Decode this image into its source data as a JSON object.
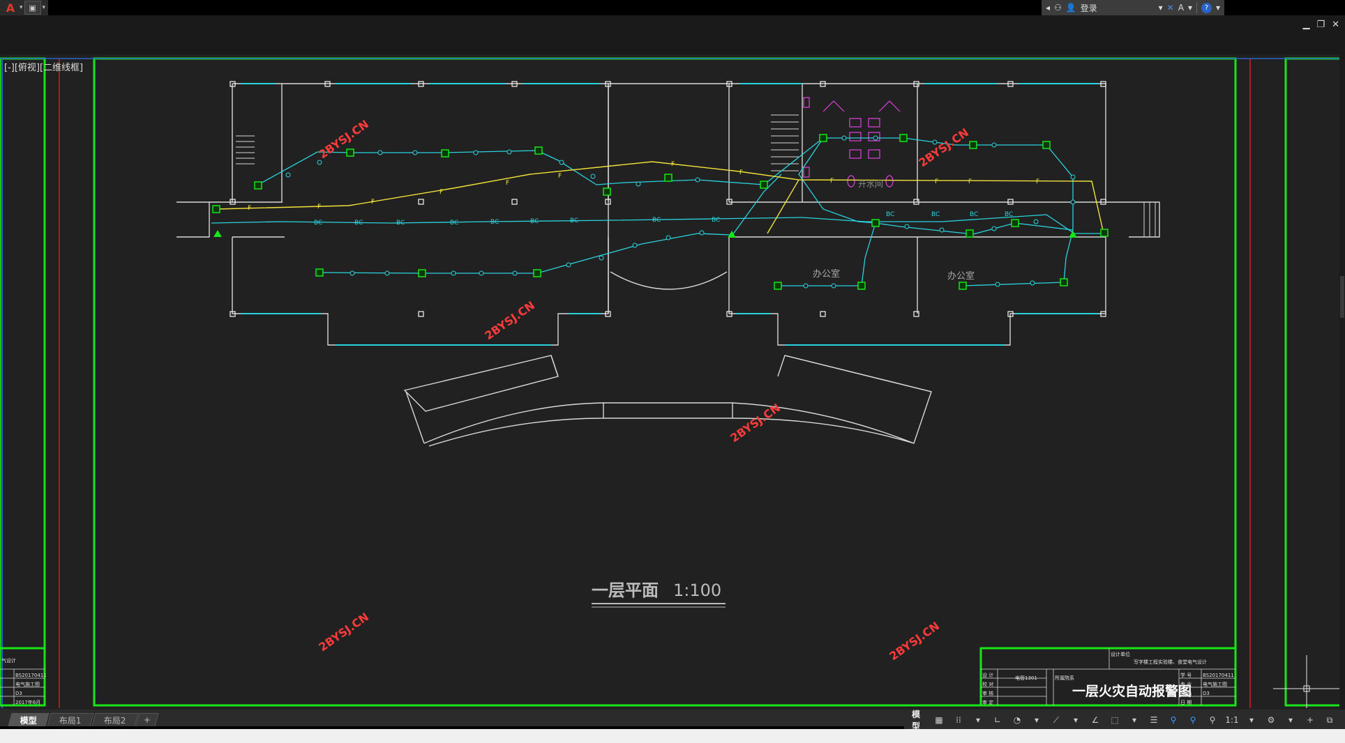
{
  "app": {
    "logo_letter": "A",
    "quick_access_icon": "save-icon"
  },
  "infocenter": {
    "login_label": "登录",
    "help_symbol": "?"
  },
  "window_controls": {
    "minimize": "▁",
    "restore": "❐",
    "close": "✕"
  },
  "viewport": {
    "view_label": "[-][俯视][二维线框]"
  },
  "drawing": {
    "watermark": "2BYSJ.CN",
    "room_office": "办公室",
    "room_stairwell": "开水间",
    "plan_title": "一层平面",
    "plan_scale": "1:100",
    "device_labels": {
      "smoke": "S",
      "fire_line": "F",
      "bc": "BC",
      "c": "C"
    }
  },
  "title_block_right": {
    "drawing_title": "一层火灾自动报警图",
    "project_name": "写字楼工程实验楼、食堂电气设计",
    "rows_left": [
      "设 计",
      "校 对",
      "审 核",
      "审 定"
    ],
    "rows_right": [
      "学 号",
      "专 业",
      "页 码",
      "日 期"
    ],
    "values_right": [
      "BS20170411",
      "电气施工图",
      "D3",
      ""
    ],
    "class_label": "电管1301",
    "school_label": "所属院系",
    "design_label": "设计单位"
  },
  "title_block_left": {
    "caption": "气设计",
    "values": [
      "BS20170411",
      "电气施工图",
      "D3",
      "2017年6月"
    ]
  },
  "layout_tabs": [
    "模型",
    "布局1",
    "布局2",
    "+"
  ],
  "statusbar": {
    "model_label": "模型",
    "scale": "1:1"
  },
  "colors": {
    "cyan": "#2ad4df",
    "yellow": "#f2e23a",
    "green": "#19e619",
    "magenta": "#e040e0",
    "red": "#e02020",
    "wall": "#d8d8d8",
    "watermark": "#ff3b3b"
  }
}
